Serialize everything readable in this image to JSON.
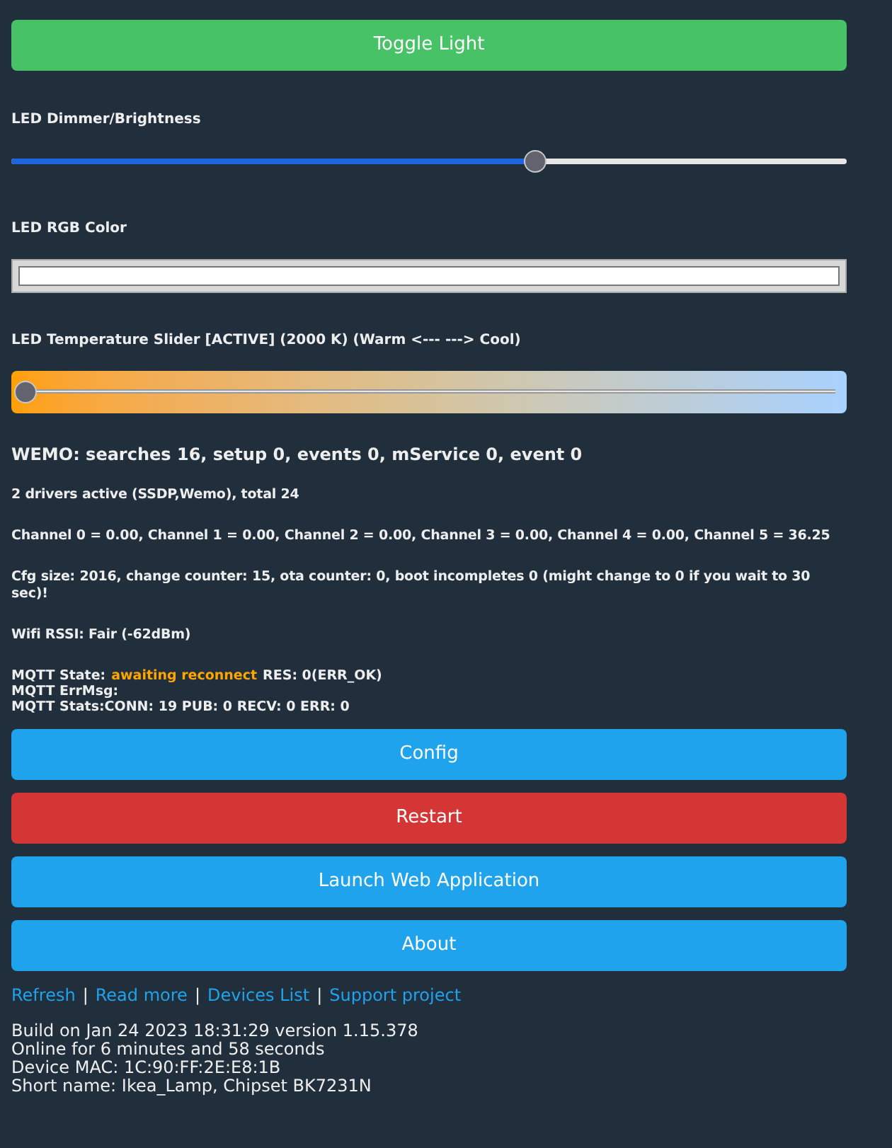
{
  "toggle_button": {
    "label": "Toggle Light"
  },
  "dimmer": {
    "label": "LED Dimmer/Brightness",
    "level": 0.63
  },
  "rgb": {
    "label": "LED RGB Color"
  },
  "temperature": {
    "label": "LED Temperature Slider [ACTIVE] (2000 K) (Warm <--- ---> Cool)",
    "level": 0.0
  },
  "wemo_heading": "WEMO: searches 16, setup 0, events 0, mService 0, event 0",
  "info_lines": [
    "2 drivers active (SSDP,Wemo), total 24",
    "Channel 0 = 0.00, Channel 1 = 0.00, Channel 2 = 0.00, Channel 3 = 0.00, Channel 4 = 0.00, Channel 5 = 36.25",
    "Cfg size: 2016, change counter: 15, ota counter: 0, boot incompletes 0 (might change to 0 if you wait to 30 sec)!",
    "Wifi RSSI: Fair (-62dBm)"
  ],
  "mqtt": {
    "state_label": "MQTT State:",
    "state": "awaiting reconnect",
    "result": "RES: 0(ERR_OK)",
    "lines": [
      "MQTT ErrMsg:",
      "MQTT Stats:CONN: 19 PUB: 0 RECV: 0 ERR: 0"
    ]
  },
  "buttons": [
    {
      "label": "Config",
      "kind": "primary"
    },
    {
      "label": "Restart",
      "kind": "danger"
    },
    {
      "label": "Launch Web Application",
      "kind": "primary"
    },
    {
      "label": "About",
      "kind": "primary"
    }
  ],
  "links": [
    {
      "label": "Refresh"
    },
    {
      "label": "Read more"
    },
    {
      "label": "Devices List"
    },
    {
      "label": "Support project"
    }
  ],
  "link_separators": [
    "|",
    "|",
    "|"
  ],
  "footer_lines": [
    "Build on Jan 24 2023 18:31:29 version 1.15.378",
    "Online for 6 minutes and 58 seconds",
    "Device MAC: 1C:90:FF:2E:E8:1B",
    "Short name: Ikea_Lamp, Chipset BK7231N"
  ]
}
